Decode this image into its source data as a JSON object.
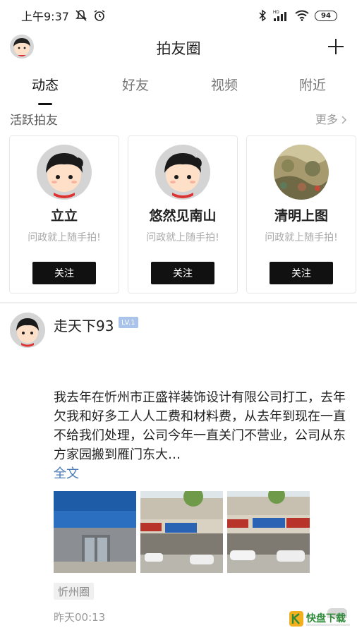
{
  "status_bar": {
    "time": "上午9:37",
    "network_label": "HD",
    "battery": "94"
  },
  "header": {
    "title": "拍友圈"
  },
  "tabs": [
    {
      "label": "动态",
      "active": true
    },
    {
      "label": "好友",
      "active": false
    },
    {
      "label": "视频",
      "active": false
    },
    {
      "label": "附近",
      "active": false
    }
  ],
  "active_section": {
    "title": "活跃拍友",
    "more": "更多",
    "cards": [
      {
        "name": "立立",
        "subtitle": "问政就上随手拍!",
        "button": "关注",
        "avatar": "cartoon-girl"
      },
      {
        "name": "悠然见南山",
        "subtitle": "问政就上随手拍!",
        "button": "关注",
        "avatar": "cartoon-girl"
      },
      {
        "name": "清明上图",
        "subtitle": "问政就上随手拍!",
        "button": "关注",
        "avatar": "painting"
      }
    ]
  },
  "post": {
    "username": "走天下93",
    "level": "LV.1",
    "text": "我去年在忻州市正盛祥装饰设计有限公司打工，去年欠我和好多工人人工费和材料费，从去年到现在一直不给我们处理，公司今年一直关门不营业，公司从东方家园搬到雁门东大…",
    "more_label": "全文",
    "tag": "忻州圈",
    "time": "昨天00:13"
  },
  "watermark": {
    "brand": "快盘下载"
  },
  "colors": {
    "accent_dark": "#111111",
    "link": "#4a7ab5",
    "level_badge": "#a9c3ea"
  }
}
